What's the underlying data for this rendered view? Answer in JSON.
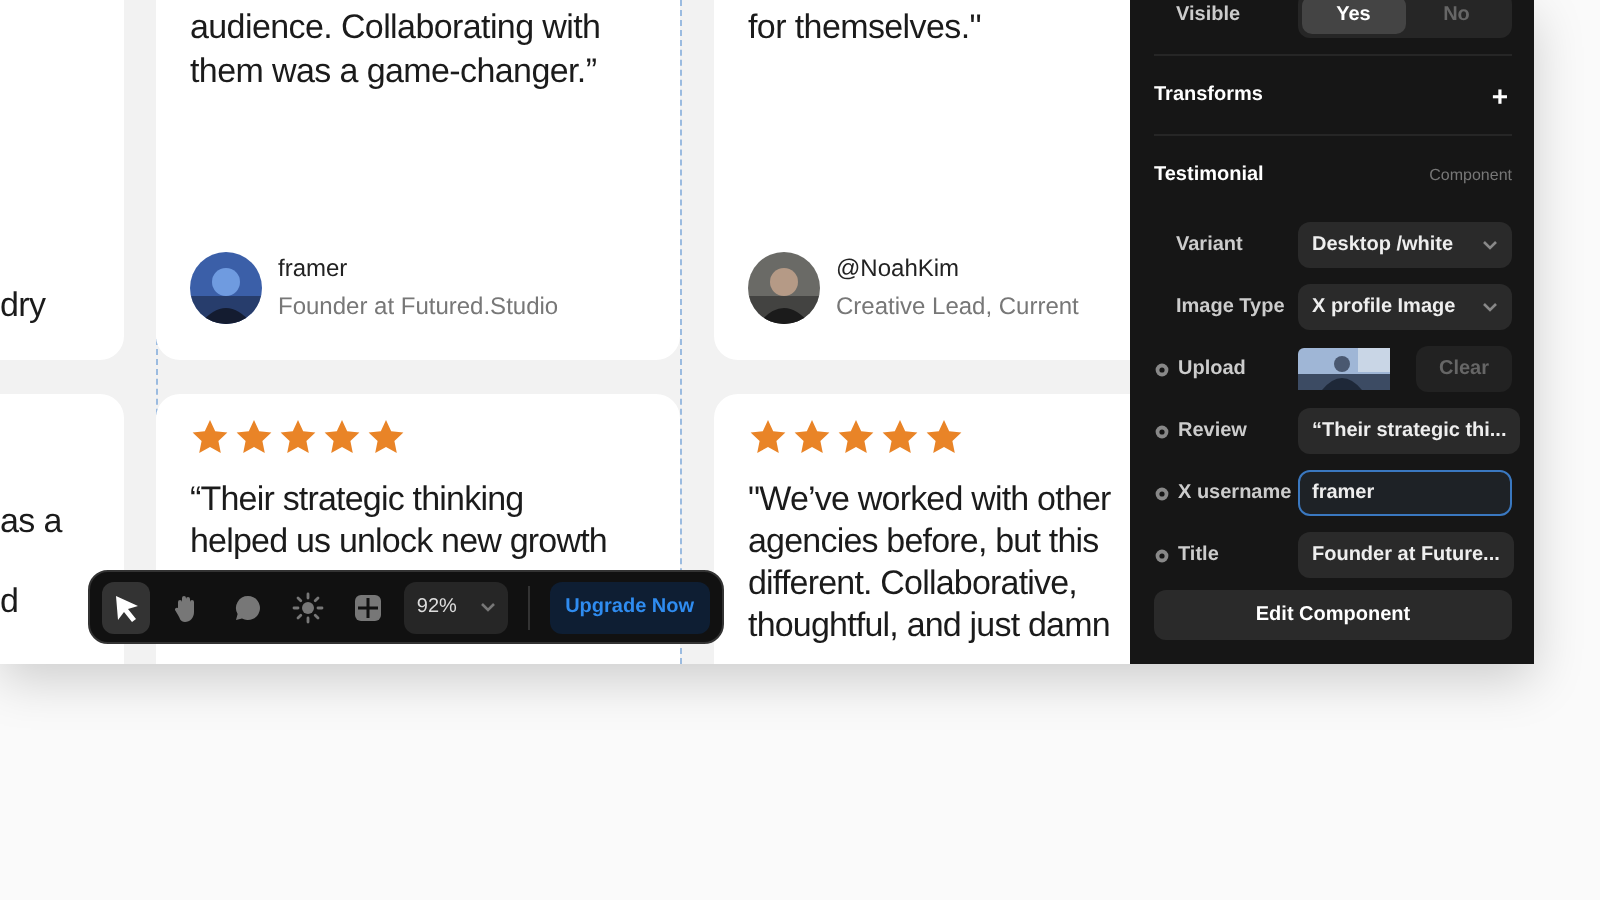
{
  "canvas": {
    "cards": [
      {
        "kind": "partial",
        "lines": [
          "dry"
        ]
      },
      {
        "kind": "testimonial",
        "lines": [
          "audience. Collaborating with",
          "them was a game-changer.”"
        ],
        "author": {
          "name": "framer",
          "role": "Founder at Futured.Studio"
        }
      },
      {
        "kind": "testimonial",
        "lines": [
          "for themselves.\""
        ],
        "author": {
          "name": "@NoahKim",
          "role": "Creative Lead, Current"
        }
      },
      {
        "kind": "partial",
        "lines": [
          "as a",
          "d"
        ]
      },
      {
        "kind": "review",
        "stars": 5,
        "lines": [
          "“Their strategic thinking",
          "helped us unlock new growth"
        ]
      },
      {
        "kind": "review",
        "stars": 5,
        "lines": [
          "\"We’ve worked with other",
          "agencies before, but this",
          "different. Collaborative,",
          "thoughtful, and just damn"
        ]
      }
    ]
  },
  "toolbar": {
    "tools": [
      {
        "kind": "pointer",
        "selected": true
      },
      {
        "kind": "hand",
        "selected": false
      },
      {
        "kind": "comment",
        "selected": false
      },
      {
        "kind": "theme",
        "selected": false
      },
      {
        "kind": "grid",
        "selected": false
      }
    ],
    "zoom": "92%",
    "upgrade": "Upgrade Now"
  },
  "panel": {
    "visible": {
      "label": "Visible",
      "options": [
        {
          "label": "Yes",
          "selected": true
        },
        {
          "label": "No",
          "selected": false
        }
      ]
    },
    "transforms": {
      "label": "Transforms",
      "button": "+"
    },
    "section": {
      "title": "Testimonial",
      "tag": "Component"
    },
    "properties": [
      {
        "kind": "select",
        "label": "Variant",
        "value": "Desktop /white",
        "dot": false
      },
      {
        "kind": "select",
        "label": "Image Type",
        "value": "X profile Image",
        "dot": false
      },
      {
        "label": "Upload",
        "button": "Clear",
        "dot": true
      },
      {
        "kind": "text",
        "label": "Review",
        "value": "“Their strategic thi...",
        "dot": true
      },
      {
        "kind": "input",
        "label": "X username",
        "value": "framer",
        "dot": true,
        "focused": true
      },
      {
        "kind": "text",
        "label": "Title",
        "value": "Founder at Future...",
        "dot": true
      }
    ],
    "action": "Edit Component"
  }
}
